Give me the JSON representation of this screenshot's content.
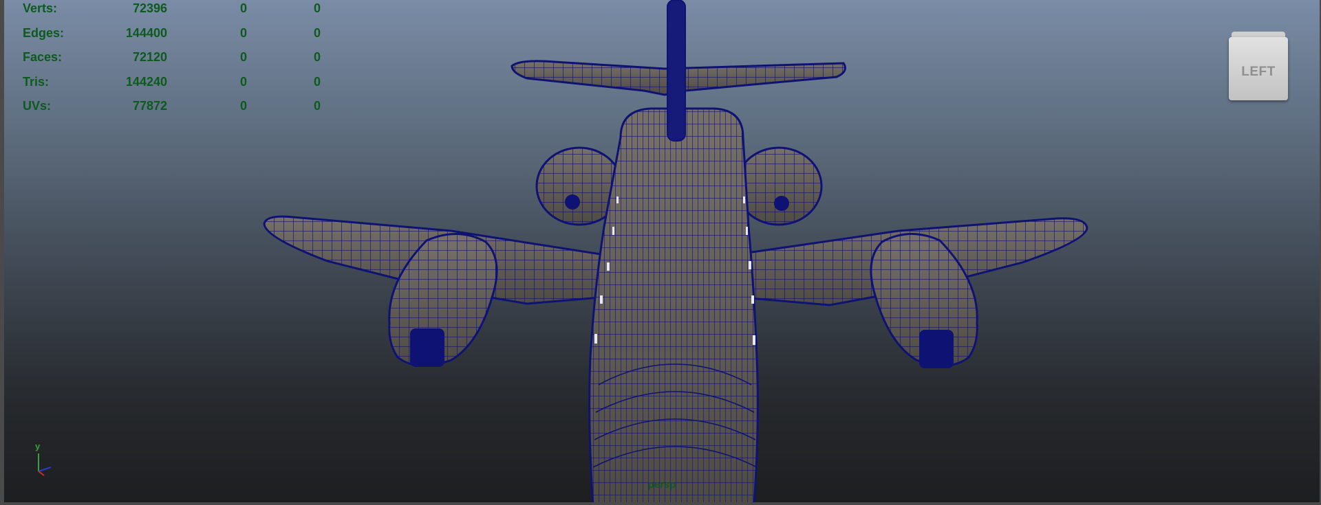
{
  "hud": {
    "rows": [
      {
        "label": "Verts:",
        "value": "72396",
        "z1": "0",
        "z2": "0"
      },
      {
        "label": "Edges:",
        "value": "144400",
        "z1": "0",
        "z2": "0"
      },
      {
        "label": "Faces:",
        "value": "72120",
        "z1": "0",
        "z2": "0"
      },
      {
        "label": "Tris:",
        "value": "144240",
        "z1": "0",
        "z2": "0"
      },
      {
        "label": "UVs:",
        "value": "77872",
        "z1": "0",
        "z2": "0"
      }
    ]
  },
  "view_cube": {
    "face_label": "LEFT"
  },
  "axis_gizmo": {
    "y_label": "y"
  },
  "camera": {
    "name": "persp"
  },
  "colors": {
    "wireframe": "#0e1272",
    "mesh_fill": "#5f5a52",
    "hud_text": "#0d5a1e"
  }
}
